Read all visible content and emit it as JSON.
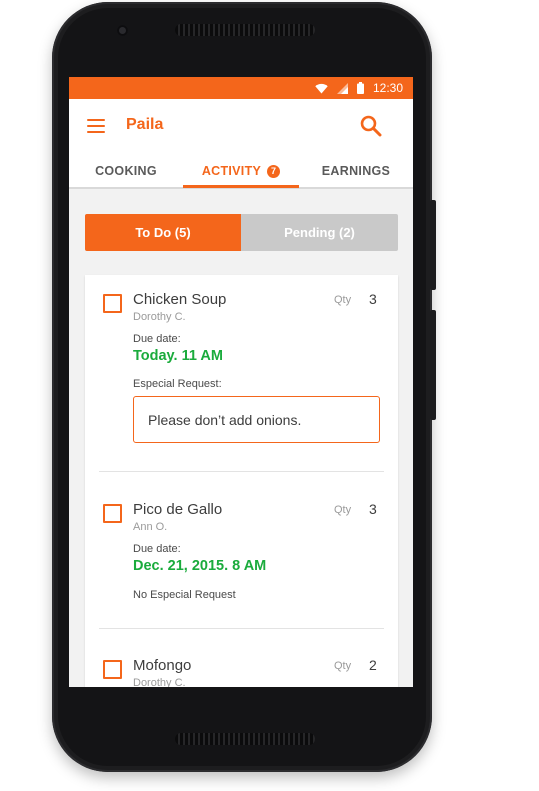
{
  "status_bar": {
    "time": "12:30"
  },
  "app_bar": {
    "title": "Paila"
  },
  "tabs": [
    {
      "label": "COOKING",
      "active": false
    },
    {
      "label": "ACTIVITY",
      "active": true,
      "badge": "7"
    },
    {
      "label": "EARNINGS",
      "active": false
    }
  ],
  "filter": {
    "todo_label": "To Do (5)",
    "pending_label": "Pending (2)",
    "selected": "todo"
  },
  "orders": [
    {
      "item": "Chicken Soup",
      "customer": "Dorothy C.",
      "qty_label": "Qty",
      "qty": "3",
      "due_label": "Due date:",
      "due": "Today. 11 AM",
      "request_label": "Especial Request:",
      "request": "Please don’t add onions."
    },
    {
      "item": "Pico de Gallo",
      "customer": "Ann O.",
      "qty_label": "Qty",
      "qty": "3",
      "due_label": "Due date:",
      "due": "Dec. 21, 2015. 8 AM",
      "request_note": "No Especial Request"
    },
    {
      "item": "Mofongo",
      "customer": "Dorothy C.",
      "qty_label": "Qty",
      "qty": "2"
    }
  ],
  "colors": {
    "accent": "#f4661b",
    "due_green": "#1aab3c",
    "segment_inactive": "#c9c9c9",
    "phone_body": "#1d1d1f"
  },
  "icons": [
    "menu-icon",
    "search-icon",
    "wifi-icon",
    "signal-icon",
    "battery-icon"
  ]
}
